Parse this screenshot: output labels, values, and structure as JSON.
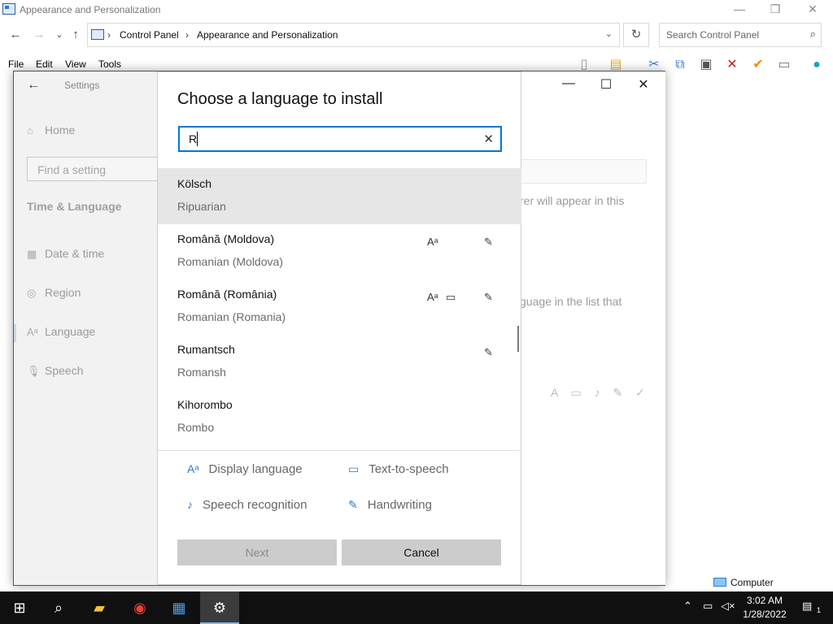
{
  "control_panel": {
    "title": "Appearance and Personalization",
    "window_buttons": {
      "minimize": "—",
      "maximize": "❐",
      "close": "✕"
    },
    "nav": {
      "back": "←",
      "forward": "→",
      "recent": "⌄",
      "up": "↑"
    },
    "breadcrumb": [
      "Control Panel",
      "Appearance and Personalization"
    ],
    "breadcrumb_separator": "›",
    "search_placeholder": "Search Control Panel",
    "menu": [
      "File",
      "Edit",
      "View",
      "Tools"
    ]
  },
  "settings": {
    "title": "Settings",
    "back": "←",
    "home": "Home",
    "find_placeholder": "Find a setting",
    "group": "Time & Language",
    "nav": [
      {
        "label": "Date & time",
        "icon": "calendar-icon"
      },
      {
        "label": "Region",
        "icon": "globe-icon"
      },
      {
        "label": "Language",
        "icon": "language-icon"
      },
      {
        "label": "Speech",
        "icon": "microphone-icon"
      }
    ],
    "window_buttons": {
      "minimize": "—",
      "maximize": "☐",
      "close": "✕"
    },
    "bg_text_1": "rer will appear in this",
    "bg_text_2": "guage in the list that"
  },
  "dialog": {
    "title": "Choose a language to install",
    "search_value": "R",
    "languages": [
      {
        "name": "Kölsch",
        "english": "Ripuarian",
        "selected": true,
        "features": []
      },
      {
        "name": "Română (Moldova)",
        "english": "Romanian (Moldova)",
        "selected": false,
        "features": [
          "display-language",
          "handwriting"
        ]
      },
      {
        "name": "Română (România)",
        "english": "Romanian (Romania)",
        "selected": false,
        "features": [
          "display-language",
          "text-to-speech",
          "handwriting"
        ]
      },
      {
        "name": "Rumantsch",
        "english": "Romansh",
        "selected": false,
        "features": [
          "handwriting"
        ]
      },
      {
        "name": "Kihorombo",
        "english": "Rombo",
        "selected": false,
        "features": []
      }
    ],
    "legend": {
      "display_language": "Display language",
      "text_to_speech": "Text-to-speech",
      "speech_recognition": "Speech recognition",
      "handwriting": "Handwriting"
    },
    "buttons": {
      "next": "Next",
      "cancel": "Cancel"
    }
  },
  "status_bar": {
    "location": "Computer"
  },
  "taskbar": {
    "time": "3:02 AM",
    "date": "1/28/2022",
    "notification_count": "1"
  }
}
